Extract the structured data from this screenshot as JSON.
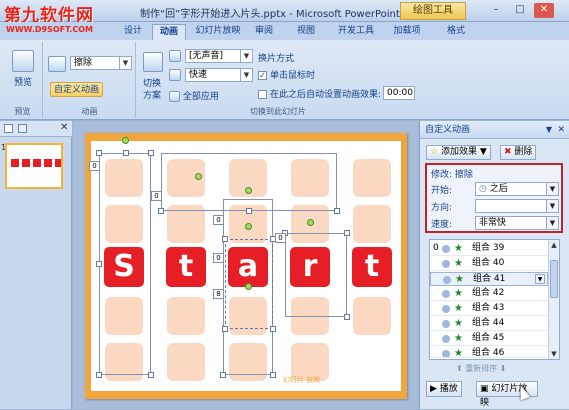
{
  "watermark": {
    "main": "第九软件网",
    "url": "WWW.D9SOFT.COM"
  },
  "window": {
    "title": "制作“回”字形开始进入片头.pptx - Microsoft PowerPoint",
    "context_tab": "绘图工具"
  },
  "tabs": [
    "设计",
    "动画",
    "幻灯片放映",
    "审阅",
    "视图",
    "开发工具",
    "加载项",
    "格式"
  ],
  "active_tab": "动画",
  "ribbon": {
    "preview": {
      "button": "预览",
      "group": "预览"
    },
    "animations": {
      "effect_value": "擦除",
      "custom_button": "自定义动画",
      "group": "动画"
    },
    "transition": {
      "scheme_label": "切换\n方案",
      "sound_value": "[无声音]",
      "speed_value": "快速",
      "apply_all": "全部应用",
      "advance_title": "换片方式",
      "on_click": "单击鼠标时",
      "auto_after": "在此之后自动设置动画效果:",
      "auto_time": "00:00",
      "group": "切换到此幻灯片"
    }
  },
  "slide": {
    "letters": [
      "S",
      "t",
      "a",
      "r",
      "t"
    ],
    "marker_labels": [
      "0",
      "0",
      "0",
      "0",
      "0",
      "8"
    ],
    "footer_text": "幻灯片 放映"
  },
  "slide_number": "1",
  "task_pane": {
    "title": "自定义动画",
    "add_effect": "添加效果",
    "remove": "删除",
    "modify_label": "修改: 擦除",
    "start_label": "开始:",
    "start_value": "之后",
    "direction_label": "方向:",
    "direction_value": "",
    "speed_label": "速度:",
    "speed_value": "非常快",
    "items": [
      {
        "num": "0",
        "label": "组合 39"
      },
      {
        "num": "",
        "label": "组合 40"
      },
      {
        "num": "",
        "label": "组合 41"
      },
      {
        "num": "",
        "label": "组合 42"
      },
      {
        "num": "",
        "label": "组合 43"
      },
      {
        "num": "",
        "label": "组合 44"
      },
      {
        "num": "",
        "label": "组合 45"
      },
      {
        "num": "",
        "label": "组合 46"
      }
    ],
    "reorder": "重新排序",
    "play": "播放",
    "slideshow": "幻灯片放映"
  }
}
